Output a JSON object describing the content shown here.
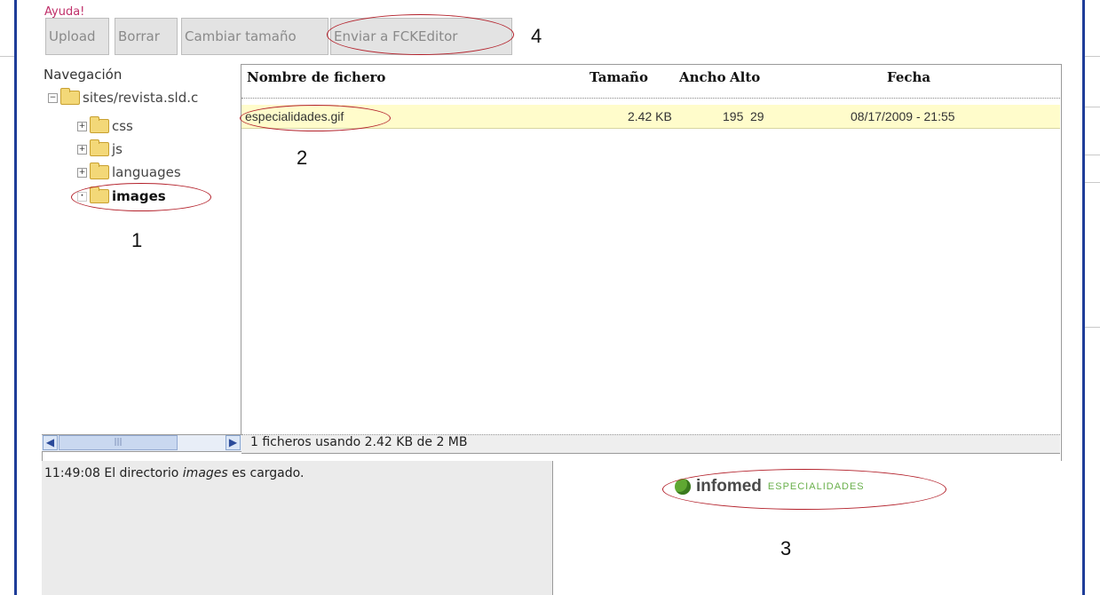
{
  "toolbar": {
    "help_label": "Ayuda!",
    "upload_label": "Upload",
    "delete_label": "Borrar",
    "resize_label": "Cambiar tamaño",
    "send_label": "Enviar a FCKEditor"
  },
  "navigation": {
    "title": "Navegación",
    "root": "sites/revista.sld.c",
    "folders": [
      "css",
      "js",
      "languages",
      "images"
    ]
  },
  "file_table": {
    "headers": [
      "Nombre de fichero",
      "Tamaño",
      "Ancho",
      "Alto",
      "Fecha"
    ],
    "rows": [
      {
        "name": "especialidades.gif",
        "size": "2.42 KB",
        "width": "195",
        "height": "29",
        "date": "08/17/2009 - 21:55"
      }
    ]
  },
  "status_bar": {
    "text": "1 ficheros usando 2.42 KB de 2 MB"
  },
  "log": {
    "time": "11:49:08",
    "message_pre": "El directorio",
    "message_dir": "images",
    "message_post": "es cargado."
  },
  "preview": {
    "logo_main": "infomed",
    "logo_sub": "ESPECIALIDADES"
  },
  "annotations": {
    "n1": "1",
    "n2": "2",
    "n3": "3",
    "n4": "4"
  },
  "colors": {
    "accent_line": "#1f3d99",
    "highlight_row": "#fffccb",
    "annotation_oval": "#b3202a"
  }
}
